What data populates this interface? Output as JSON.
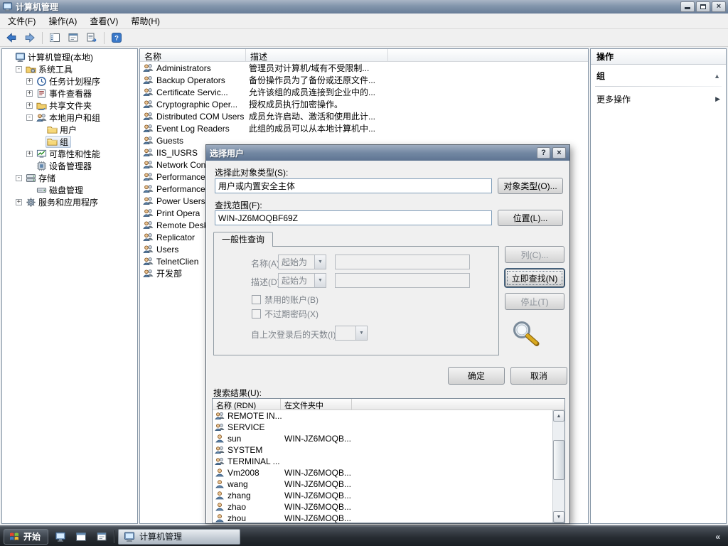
{
  "window": {
    "title": "计算机管理",
    "menu": [
      "文件(F)",
      "操作(A)",
      "查看(V)",
      "帮助(H)"
    ]
  },
  "glyphs": {
    "window_close": "×",
    "dialog_help": "?",
    "dialog_close": "×",
    "dropdown": "▼",
    "scroll_up": "▲",
    "scroll_down": "▼",
    "section_collapse": "▲",
    "more_arrow": "▶"
  },
  "icons": {
    "back-icon": "blue-left-arrow",
    "forward-icon": "blue-right-arrow",
    "show-console-tree-icon": "window-with-tree",
    "export-list-icon": "list-with-arrow",
    "properties-icon": "window-with-lines",
    "help-icon": "blue-question-square",
    "search-magnifier-icon": "magnifying-glass",
    "group-icon": "two-person-heads",
    "user-icon": "single-person",
    "windows-flag-icon": "four-color-flag"
  },
  "colors": {
    "titlebar_top": "#aab6c6",
    "titlebar_bottom": "#687d98",
    "selection_inactive": "#d3dfee",
    "taskbar": "#272c32",
    "input_border": "#7f9db9",
    "disabled_text": "#7e848b"
  },
  "tree": {
    "items": [
      {
        "id": "computer-management-local",
        "level": 0,
        "expander": "",
        "icon": "computer",
        "label": "计算机管理(本地)"
      },
      {
        "id": "system-tools",
        "level": 1,
        "expander": "-",
        "icon": "tools",
        "label": "系统工具"
      },
      {
        "id": "task-scheduler",
        "level": 2,
        "expander": "+",
        "icon": "scheduler",
        "label": "任务计划程序"
      },
      {
        "id": "event-viewer",
        "level": 2,
        "expander": "+",
        "icon": "events",
        "label": "事件查看器"
      },
      {
        "id": "shared-folders",
        "level": 2,
        "expander": "+",
        "icon": "share",
        "label": "共享文件夹"
      },
      {
        "id": "local-users-and-groups",
        "level": 2,
        "expander": "-",
        "icon": "localusers",
        "label": "本地用户和组"
      },
      {
        "id": "users-folder",
        "level": 3,
        "expander": "",
        "icon": "folder",
        "label": "用户"
      },
      {
        "id": "groups-folder",
        "level": 3,
        "expander": "",
        "icon": "folder",
        "label": "组",
        "selected": true
      },
      {
        "id": "reliability-and-performance",
        "level": 2,
        "expander": "+",
        "icon": "perf",
        "label": "可靠性和性能"
      },
      {
        "id": "device-manager",
        "level": 2,
        "expander": "",
        "icon": "device",
        "label": "设备管理器"
      },
      {
        "id": "storage",
        "level": 1,
        "expander": "-",
        "icon": "storage",
        "label": "存储"
      },
      {
        "id": "disk-management",
        "level": 2,
        "expander": "",
        "icon": "disk",
        "label": "磁盘管理"
      },
      {
        "id": "services-and-applications",
        "level": 1,
        "expander": "+",
        "icon": "services",
        "label": "服务和应用程序"
      }
    ]
  },
  "group_list": {
    "columns": [
      "名称",
      "描述"
    ],
    "rows": [
      {
        "name": "Administrators",
        "desc": "管理员对计算机/域有不受限制..."
      },
      {
        "name": "Backup Operators",
        "desc": "备份操作员为了备份或还原文件..."
      },
      {
        "name": "Certificate Servic...",
        "desc": "允许该组的成员连接到企业中的..."
      },
      {
        "name": "Cryptographic Oper...",
        "desc": "授权成员执行加密操作。"
      },
      {
        "name": "Distributed COM Users",
        "desc": "成员允许启动、激活和使用此计..."
      },
      {
        "name": "Event Log Readers",
        "desc": "此组的成员可以从本地计算机中..."
      },
      {
        "name": "Guests",
        "desc": ""
      },
      {
        "name": "IIS_IUSRS",
        "desc": ""
      },
      {
        "name": "Network Con",
        "desc": ""
      },
      {
        "name": "Performance",
        "desc": ""
      },
      {
        "name": "Performance",
        "desc": ""
      },
      {
        "name": "Power Users",
        "desc": ""
      },
      {
        "name": "Print Opera",
        "desc": ""
      },
      {
        "name": "Remote Desk",
        "desc": ""
      },
      {
        "name": "Replicator",
        "desc": ""
      },
      {
        "name": "Users",
        "desc": ""
      },
      {
        "name": "TelnetClien",
        "desc": ""
      },
      {
        "name": "开发部",
        "desc": ""
      }
    ]
  },
  "actions": {
    "title": "操作",
    "section": "组",
    "more": "更多操作"
  },
  "dialog": {
    "title": "选择用户",
    "object_type_label": "选择此对象类型(S):",
    "object_type_value": "用户或内置安全主体",
    "object_type_button": "对象类型(O)...",
    "location_label": "查找范围(F):",
    "location_value": "WIN-JZ6MOQBF69Z",
    "location_button": "位置(L)...",
    "tab_label": "一般性查询",
    "name_label": "名称(A):",
    "name_operator": "起始为",
    "name_value": "",
    "desc_label": "描述(D):",
    "desc_operator": "起始为",
    "desc_value": "",
    "checkbox_disabled_accounts": "禁用的账户(B)",
    "checkbox_non_expiring": "不过期密码(X)",
    "days_label": "自上次登录后的天数(I):",
    "days_value": "",
    "columns_button": "列(C)...",
    "find_now_button": "立即查找(N)",
    "stop_button": "停止(T)",
    "ok_button": "确定",
    "cancel_button": "取消",
    "results_label": "搜索结果(U):",
    "results_columns": [
      "名称 (RDN)",
      "在文件夹中"
    ],
    "results": [
      {
        "name": "REMOTE IN...",
        "folder": "",
        "type": "group"
      },
      {
        "name": "SERVICE",
        "folder": "",
        "type": "group"
      },
      {
        "name": "sun",
        "folder": "WIN-JZ6MOQB...",
        "type": "user"
      },
      {
        "name": "SYSTEM",
        "folder": "",
        "type": "group"
      },
      {
        "name": "TERMINAL ...",
        "folder": "",
        "type": "group"
      },
      {
        "name": "Vm2008",
        "folder": "WIN-JZ6MOQB...",
        "type": "user"
      },
      {
        "name": "wang",
        "folder": "WIN-JZ6MOQB...",
        "type": "user"
      },
      {
        "name": "zhang",
        "folder": "WIN-JZ6MOQB...",
        "type": "user"
      },
      {
        "name": "zhao",
        "folder": "WIN-JZ6MOQB...",
        "type": "user"
      },
      {
        "name": "zhou",
        "folder": "WIN-JZ6MOQB...",
        "type": "user"
      }
    ]
  },
  "taskbar": {
    "start": "开始",
    "task": "计算机管理",
    "chevron": "«"
  }
}
